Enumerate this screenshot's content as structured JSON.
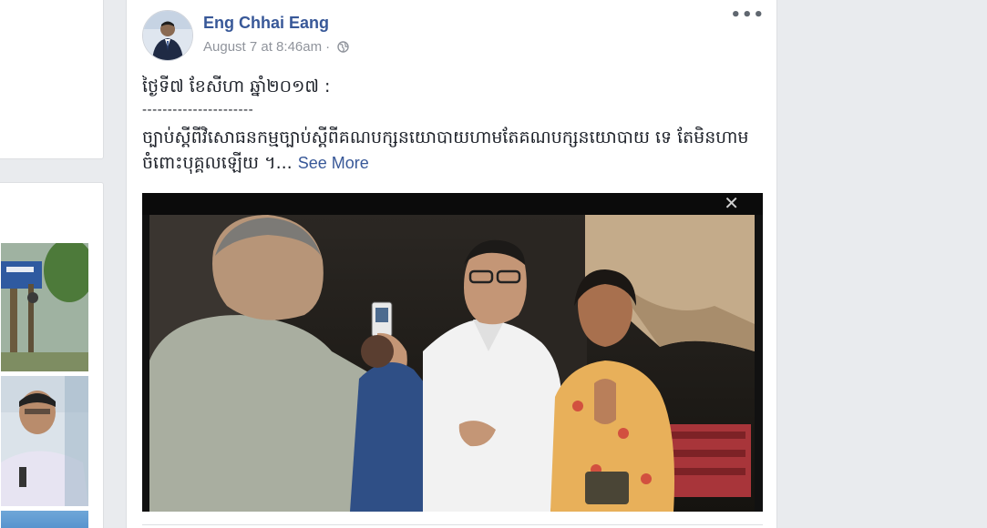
{
  "post": {
    "author": "Eng Chhai Eang",
    "timestamp": "August 7 at 8:46am",
    "separator_dot": "·",
    "privacy_icon": "globe-icon",
    "more_label": "•••",
    "line1": "ថ្ងៃទី៧ ខែសីហា ឆ្នាំ២០១៧ :",
    "line2": "----------------------",
    "body": "ច្បាប់ស្តីពីវិសោធនកម្មច្បាប់ស្តីពីគណបក្សនយោបាយហាមតែគណបក្សនយោបាយ ទេ តែមិនហាមចំពោះបុគ្គលឡើយ ។...",
    "see_more": "See More",
    "video_close": "✕"
  },
  "colors": {
    "link": "#385898",
    "meta": "#90949c",
    "background": "#e9ebee"
  }
}
